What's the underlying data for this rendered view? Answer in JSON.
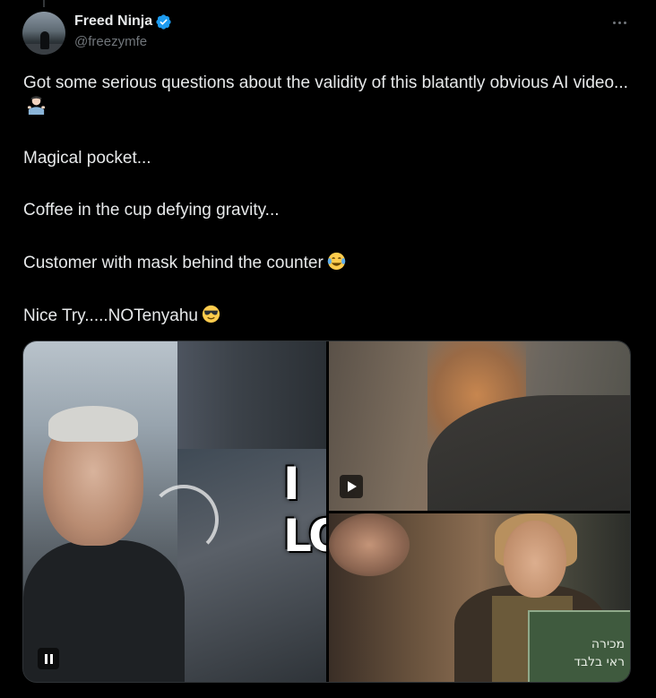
{
  "author": {
    "display_name": "Freed Ninja",
    "handle": "@freezymfe",
    "verified": true
  },
  "icons": {
    "verified": "verified-badge-icon",
    "more": "more-options-icon",
    "pause": "pause-icon",
    "play": "play-icon"
  },
  "colors": {
    "background": "#000000",
    "text": "#e7e9ea",
    "secondary_text": "#71767b",
    "verified_blue": "#1d9bf0"
  },
  "tweet": {
    "line1": "Got some serious questions about the validity of this blatantly obvious AI video...",
    "line1_emoji": "man-shrugging-emoji",
    "line2": "Magical pocket...",
    "line3": "Coffee in the cup defying gravity...",
    "line4": "Customer with mask behind the counter",
    "line4_emoji": "face-with-tears-of-joy-emoji",
    "line5": "Nice Try.....NOTenyahu",
    "line5_emoji": "smiling-face-with-sunglasses-emoji"
  },
  "media": {
    "main_overlay_text": "I LO",
    "sign_text_line1": "מכירה",
    "sign_text_line2": "ראי בלבד"
  }
}
